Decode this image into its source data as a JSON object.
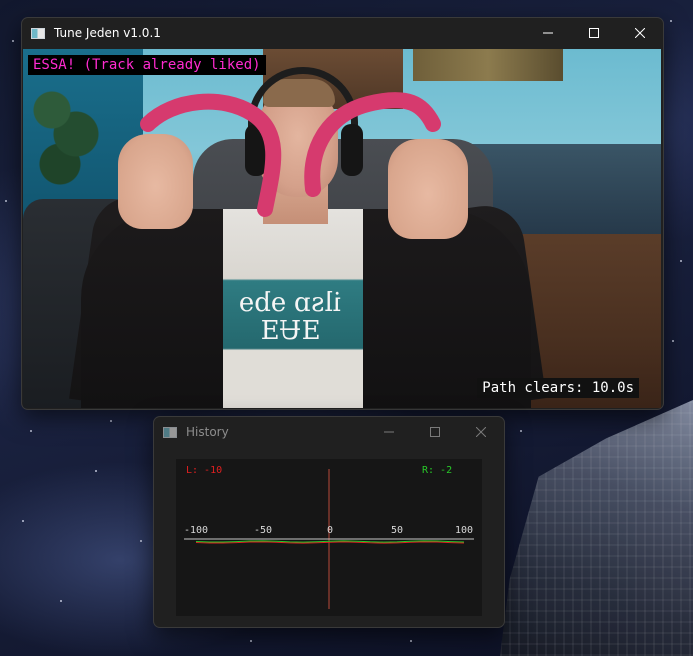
{
  "main_window": {
    "title": "Tune Jeden v1.0.1",
    "status_text": "ESSA! (Track already liked)",
    "path_clears_text": "Path clears: 10.0s",
    "shirt_text": "ilsɒ ɘbɘ ƎɄƎ",
    "stroke_color": "#d63a6e"
  },
  "history_window": {
    "title": "History",
    "left_label": "L: -10",
    "right_label": "R: -2",
    "left_color": "#e02020",
    "right_color": "#28c828",
    "chart_data": {
      "type": "line",
      "x_ticks": [
        "-100",
        "-50",
        "0",
        "50",
        "100"
      ],
      "xlim": [
        -100,
        100
      ],
      "series": [
        {
          "name": "L",
          "color": "#e02020",
          "values": [
            -8,
            -9,
            -10,
            -10,
            -9,
            -10,
            -11,
            -10,
            -10,
            -9,
            -10,
            -10,
            -11,
            -10,
            -9,
            -10,
            -10,
            -10,
            -11,
            -10,
            -10
          ]
        },
        {
          "name": "R",
          "color": "#28c828",
          "values": [
            -3,
            -2,
            -2,
            -3,
            -2,
            -1,
            -2,
            -2,
            -3,
            -2,
            -2,
            -1,
            -2,
            -3,
            -2,
            -2,
            -2,
            -1,
            -2,
            -2,
            -2
          ]
        }
      ]
    }
  }
}
